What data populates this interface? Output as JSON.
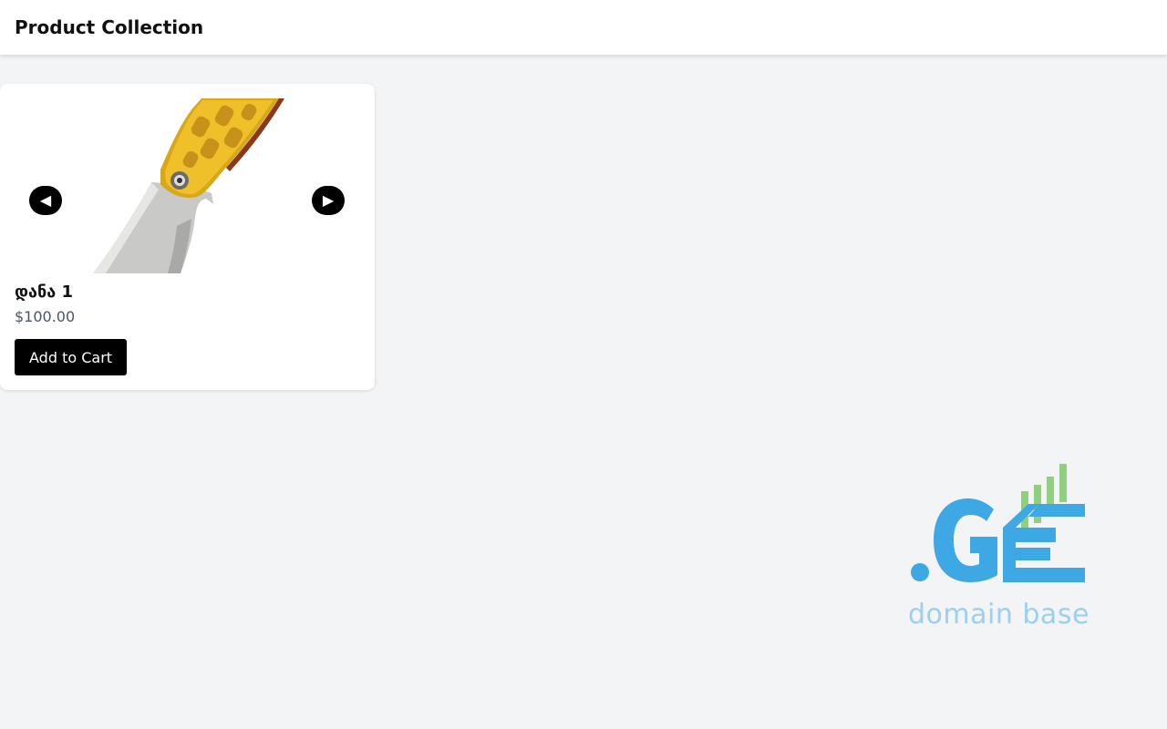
{
  "header": {
    "title": "Product Collection"
  },
  "products": [
    {
      "name": "დანა 1",
      "price": "$100.00",
      "add_to_cart_label": "Add to Cart",
      "image_icon": "folding-knife-image",
      "prev_label": "◀",
      "next_label": "▶"
    }
  ],
  "watermark": {
    "logo_text": ".GE",
    "tagline": "domain base"
  },
  "colors": {
    "background": "#f3f4f6",
    "card": "#ffffff",
    "button": "#000000",
    "logo_blue": "#3ea8e5",
    "logo_green": "#8fcf7d",
    "tagline": "#9dcff0"
  }
}
